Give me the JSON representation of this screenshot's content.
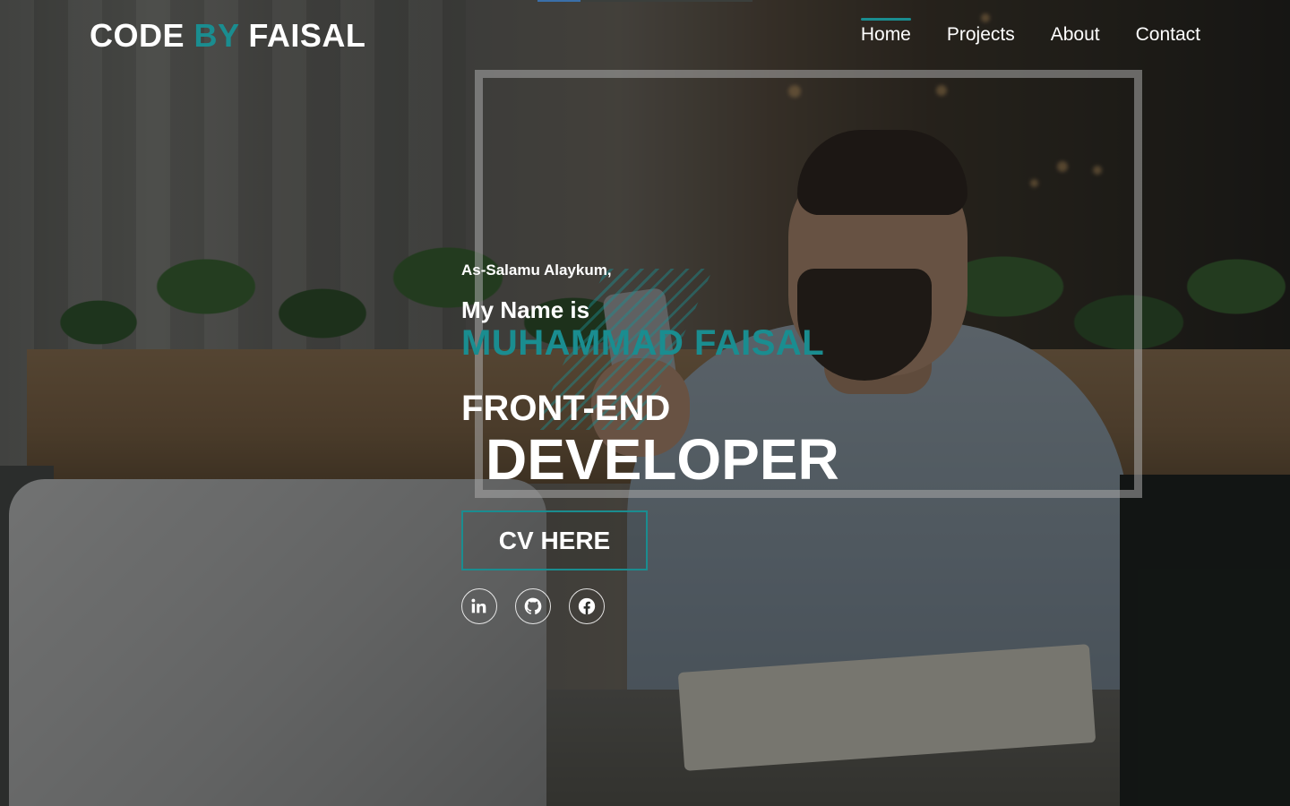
{
  "header": {
    "logo": {
      "part1": "CODE ",
      "accent": "BY",
      "part2": " FAISAL"
    },
    "nav": [
      {
        "label": "Home",
        "active": true
      },
      {
        "label": "Projects",
        "active": false
      },
      {
        "label": "About",
        "active": false
      },
      {
        "label": "Contact",
        "active": false
      }
    ]
  },
  "hero": {
    "greeting": "As-Salamu Alaykum,",
    "intro": "My Name is",
    "name": "MUHAMMAD FAISAL",
    "role_line1": "FRONT-END",
    "role_line2": "DEVELOPER",
    "cv_label": "CV HERE"
  },
  "socials": [
    {
      "icon": "linkedin-icon"
    },
    {
      "icon": "github-icon"
    },
    {
      "icon": "facebook-icon"
    }
  ],
  "colors": {
    "accent": "#1a8d90",
    "text": "#ffffff",
    "nav_underline": "#1a8d90"
  }
}
